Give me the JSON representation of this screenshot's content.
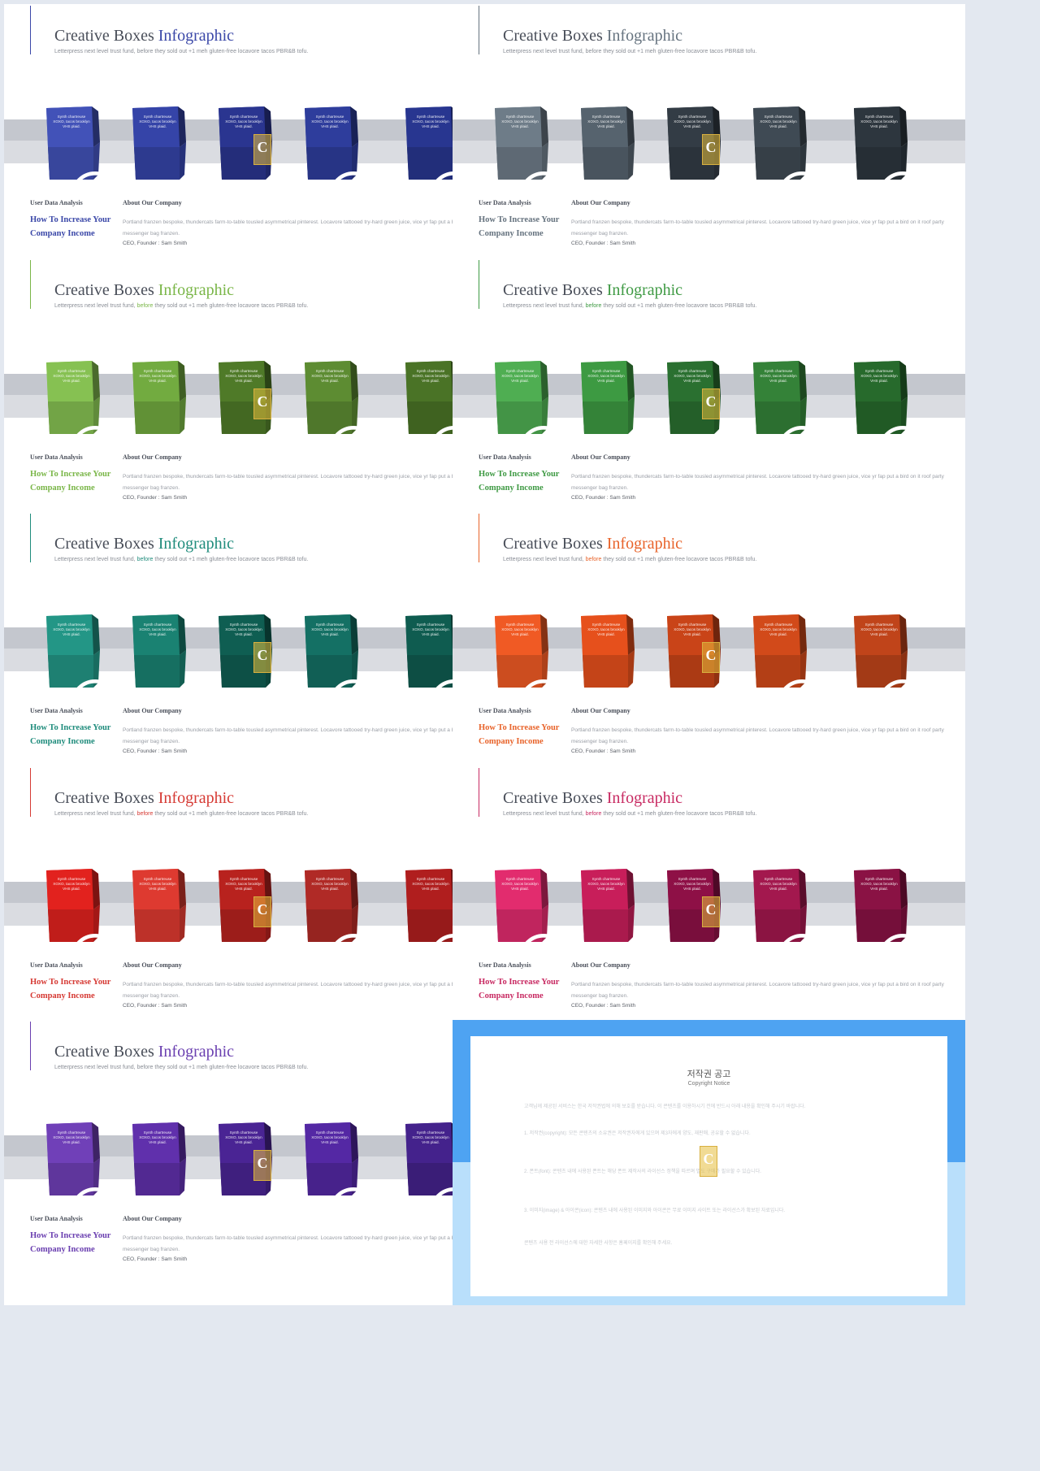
{
  "slides": [
    {
      "title": "Creative Boxes",
      "title_accent": "Infographic",
      "subtitle_pre": "Letterpress next level trust fund,",
      "subtitle_accent": "before",
      "subtitle_post": "they sold out +1 meh gluten-free locavore tacos PBR&B tofu.",
      "label_analysis": "User Data Analysis",
      "headline": "How To Increase Your Company Income",
      "label_company": "About Our Company",
      "description": "Portland franzen bespoke, thundercats farm-to-table tousled asymmetrical pinterest. Locavore tattooed try-hard green juice, vice yr fap put a bird on it roof party messenger bag franzen.",
      "ceo": "CEO, Founder : Sam Smith",
      "accent": "#3b48a8",
      "subtitle_accent_color": "#8a8e96",
      "box_colors": [
        "#4252b8",
        "#3544a8",
        "#2a3590",
        "#2e3d9c",
        "#283690"
      ],
      "box_text": "Synth chartreuse XOXO, tacos brooklyn VHS plaid."
    },
    {
      "title": "Creative Boxes",
      "title_accent": "Infographic",
      "subtitle_pre": "Letterpress next level trust fund,",
      "subtitle_accent": "before",
      "subtitle_post": "they sold out +1 meh gluten-free locavore tacos PBR&B tofu.",
      "label_analysis": "User Data Analysis",
      "headline": "How To Increase Your Company Income",
      "label_company": "About Our Company",
      "description": "Portland franzen bespoke, thundercats farm-to-table tousled asymmetrical pinterest. Locavore tattooed try-hard green juice, vice yr fap put a bird on it roof party messenger bag franzen.",
      "ceo": "CEO, Founder : Sam Smith",
      "accent": "#66737f",
      "subtitle_accent_color": "#8a8e96",
      "box_colors": [
        "#6e7c88",
        "#56636e",
        "#333c45",
        "#3f4a54",
        "#2d363e"
      ],
      "box_text": "Synth chartreuse XOXO, tacos brooklyn VHS plaid."
    },
    {
      "title": "Creative Boxes",
      "title_accent": "Infographic",
      "subtitle_pre": "Letterpress next level trust fund,",
      "subtitle_accent": "before",
      "subtitle_post": "they sold out +1 meh gluten-free locavore tacos PBR&B tofu.",
      "label_analysis": "User Data Analysis",
      "headline": "How To Increase Your Company Income",
      "label_company": "About Our Company",
      "description": "Portland franzen bespoke, thundercats farm-to-table tousled asymmetrical pinterest. Locavore tattooed try-hard green juice, vice yr fap put a bird on it roof party messenger bag franzen.",
      "ceo": "CEO, Founder : Sam Smith",
      "accent": "#7ab648",
      "subtitle_accent_color": "#7ab648",
      "box_colors": [
        "#86c152",
        "#72ab40",
        "#4f7a28",
        "#5d8c32",
        "#4a7326"
      ],
      "box_text": "Synth chartreuse XOXO, tacos brooklyn VHS plaid."
    },
    {
      "title": "Creative Boxes",
      "title_accent": "Infographic",
      "subtitle_pre": "Letterpress next level trust fund,",
      "subtitle_accent": "before",
      "subtitle_post": "they sold out +1 meh gluten-free locavore tacos PBR&B tofu.",
      "label_analysis": "User Data Analysis",
      "headline": "How To Increase Your Company Income",
      "label_company": "About Our Company",
      "description": "Portland franzen bespoke, thundercats farm-to-table tousled asymmetrical pinterest. Locavore tattooed try-hard green juice, vice yr fap put a bird on it roof party messenger bag franzen.",
      "ceo": "CEO, Founder : Sam Smith",
      "accent": "#3f9a44",
      "subtitle_accent_color": "#3f9a44",
      "box_colors": [
        "#4fae52",
        "#3d9a42",
        "#2a7030",
        "#348238",
        "#276a2c"
      ],
      "box_text": "Synth chartreuse XOXO, tacos brooklyn VHS plaid."
    },
    {
      "title": "Creative Boxes",
      "title_accent": "Infographic",
      "subtitle_pre": "Letterpress next level trust fund,",
      "subtitle_accent": "before",
      "subtitle_post": "they sold out +1 meh gluten-free locavore tacos PBR&B tofu.",
      "label_analysis": "User Data Analysis",
      "headline": "How To Increase Your Company Income",
      "label_company": "About Our Company",
      "description": "Portland franzen bespoke, thundercats farm-to-table tousled asymmetrical pinterest. Locavore tattooed try-hard green juice, vice yr fap put a bird on it roof party messenger bag franzen.",
      "ceo": "CEO, Founder : Sam Smith",
      "accent": "#1f8c7c",
      "subtitle_accent_color": "#1f8c7c",
      "box_colors": [
        "#239686",
        "#1a8272",
        "#0f5e52",
        "#147064",
        "#0f5c50"
      ],
      "box_text": "Synth chartreuse XOXO, tacos brooklyn VHS plaid."
    },
    {
      "title": "Creative Boxes",
      "title_accent": "Infographic",
      "subtitle_pre": "Letterpress next level trust fund,",
      "subtitle_accent": "before",
      "subtitle_post": "they sold out +1 meh gluten-free locavore tacos PBR&B tofu.",
      "label_analysis": "User Data Analysis",
      "headline": "How To Increase Your Company Income",
      "label_company": "About Our Company",
      "description": "Portland franzen bespoke, thundercats farm-to-table tousled asymmetrical pinterest. Locavore tattooed try-hard green juice, vice yr fap put a bird on it roof party messenger bag franzen.",
      "ceo": "CEO, Founder : Sam Smith",
      "accent": "#e8632a",
      "subtitle_accent_color": "#e8632a",
      "box_colors": [
        "#f05a24",
        "#e6501c",
        "#c94418",
        "#d24a1a",
        "#c0441a"
      ],
      "box_text": "Synth chartreuse XOXO, tacos brooklyn VHS plaid."
    },
    {
      "title": "Creative Boxes",
      "title_accent": "Infographic",
      "subtitle_pre": "Letterpress next level trust fund,",
      "subtitle_accent": "before",
      "subtitle_post": "they sold out +1 meh gluten-free locavore tacos PBR&B tofu.",
      "label_analysis": "User Data Analysis",
      "headline": "How To Increase Your Company Income",
      "label_company": "About Our Company",
      "description": "Portland franzen bespoke, thundercats farm-to-table tousled asymmetrical pinterest. Locavore tattooed try-hard green juice, vice yr fap put a bird on it roof party messenger bag franzen.",
      "ceo": "CEO, Founder : Sam Smith",
      "accent": "#d63a34",
      "subtitle_accent_color": "#d63a34",
      "box_colors": [
        "#e2221e",
        "#de3a30",
        "#b8221e",
        "#b02a26",
        "#b01e1e"
      ],
      "box_text": "Synth chartreuse XOXO, tacos brooklyn VHS plaid."
    },
    {
      "title": "Creative Boxes",
      "title_accent": "Infographic",
      "subtitle_pre": "Letterpress next level trust fund,",
      "subtitle_accent": "before",
      "subtitle_post": "they sold out +1 meh gluten-free locavore tacos PBR&B tofu.",
      "label_analysis": "User Data Analysis",
      "headline": "How To Increase Your Company Income",
      "label_company": "About Our Company",
      "description": "Portland franzen bespoke, thundercats farm-to-table tousled asymmetrical pinterest. Locavore tattooed try-hard green juice, vice yr fap put a bird on it roof party messenger bag franzen.",
      "ceo": "CEO, Founder : Sam Smith",
      "accent": "#c82a62",
      "subtitle_accent_color": "#c82a62",
      "box_colors": [
        "#e22c6e",
        "#c81e5a",
        "#8e1046",
        "#a3184e",
        "#8a1244"
      ],
      "box_text": "Synth chartreuse XOXO, tacos brooklyn VHS plaid."
    },
    {
      "title": "Creative Boxes",
      "title_accent": "Infographic",
      "subtitle_pre": "Letterpress next level trust fund,",
      "subtitle_accent": "before",
      "subtitle_post": "they sold out +1 meh gluten-free locavore tacos PBR&B tofu.",
      "label_analysis": "User Data Analysis",
      "headline": "How To Increase Your Company Income",
      "label_company": "About Our Company",
      "description": "Portland franzen bespoke, thundercats farm-to-table tousled asymmetrical pinterest. Locavore tattooed try-hard green juice, vice yr fap put a bird on it roof party messenger bag franzen.",
      "ceo": "CEO, Founder : Sam Smith",
      "accent": "#6a3fb0",
      "subtitle_accent_color": "#8a8e96",
      "box_colors": [
        "#7040b8",
        "#6030ac",
        "#4a2494",
        "#5428a4",
        "#44228c"
      ],
      "box_text": "Synth chartreuse XOXO, tacos brooklyn VHS plaid."
    }
  ],
  "watermark_letter": "C",
  "notice": {
    "title": "저작권 공고",
    "subtitle": "Copyright Notice",
    "paragraphs": [
      "고객님께 제공된 서비스는 한국 저작권법에 의해 보호를 받습니다. 이 콘텐츠를 이용하시기 전에 반드시 아래 내용을 확인해 주시기 바랍니다.",
      "1. 저작권(copyright): 모든 콘텐츠의 소유권은 저작권자에게 있으며 제3자에게 양도, 재판매, 공유할 수 없습니다.",
      "2. 폰트(font): 콘텐츠 내에 사용된 폰트는 해당 폰트 제작사의 라이선스 정책을 따르며 별도 구매가 필요할 수 있습니다.",
      "3. 이미지(image) & 아이콘(icon): 콘텐츠 내에 사용된 이미지와 아이콘은 무료 이미지 사이트 또는 라이선스가 확보된 자료입니다.",
      "콘텐츠 사용 전 라이선스에 대한 자세한 사항은 홈페이지를 확인해 주세요."
    ]
  }
}
